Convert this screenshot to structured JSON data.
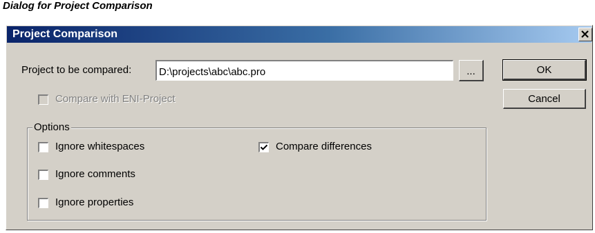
{
  "caption": "Dialog for Project Comparison",
  "window": {
    "title": "Project Comparison",
    "close_glyph": "✕"
  },
  "form": {
    "project_label": "Project to be compared:",
    "project_value": "D:\\projects\\abc\\abc.pro",
    "browse_label": "...",
    "eni_label": "Compare with ENI-Project",
    "eni_checked": false,
    "eni_disabled": true
  },
  "buttons": {
    "ok": "OK",
    "cancel": "Cancel"
  },
  "options": {
    "legend": "Options",
    "ignore_whitespaces": {
      "label": "Ignore whitespaces",
      "checked": false
    },
    "ignore_comments": {
      "label": "Ignore comments",
      "checked": false
    },
    "ignore_properties": {
      "label": "Ignore properties",
      "checked": false
    },
    "compare_differences": {
      "label": "Compare differences",
      "checked": true
    }
  },
  "colors": {
    "face": "#d4d0c8",
    "title_start": "#0a246a",
    "title_end": "#a6caf0"
  }
}
